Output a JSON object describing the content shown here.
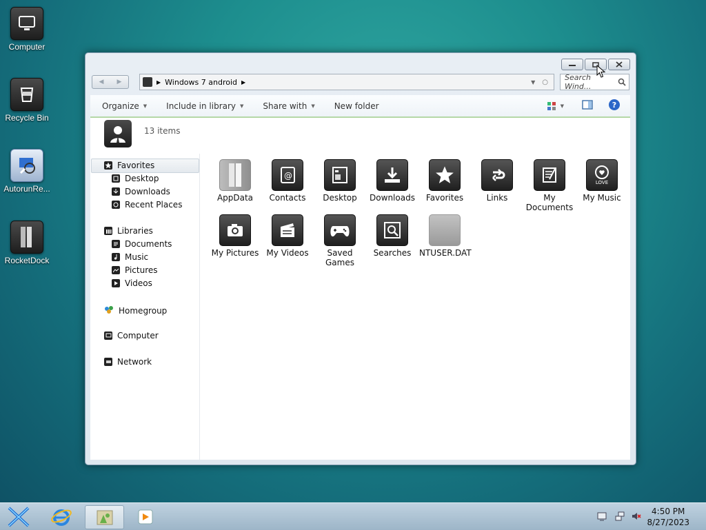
{
  "desktop": {
    "icons": [
      {
        "label": "Computer",
        "icon": "computer-icon"
      },
      {
        "label": "Recycle Bin",
        "icon": "recycle-bin-icon"
      },
      {
        "label": "AutorunRe...",
        "icon": "autorun-icon"
      },
      {
        "label": "RocketDock",
        "icon": "rocketdock-icon"
      }
    ]
  },
  "window": {
    "address": {
      "root_icon": "user-icon",
      "segment": "Windows 7 android"
    },
    "search_placeholder": "Search Wind...",
    "toolbar": {
      "organize": "Organize",
      "include": "Include in library",
      "share": "Share with",
      "new_folder": "New folder"
    },
    "info": {
      "count": "13 items"
    },
    "nav": {
      "favorites": "Favorites",
      "desktop": "Desktop",
      "downloads": "Downloads",
      "recent": "Recent Places",
      "libraries": "Libraries",
      "documents": "Documents",
      "music": "Music",
      "pictures": "Pictures",
      "videos": "Videos",
      "homegroup": "Homegroup",
      "computer": "Computer",
      "network": "Network"
    },
    "files": [
      {
        "label": "AppData",
        "icon": "folder-icon"
      },
      {
        "label": "Contacts",
        "icon": "contacts-icon"
      },
      {
        "label": "Desktop",
        "icon": "desktop-icon"
      },
      {
        "label": "Downloads",
        "icon": "download-icon"
      },
      {
        "label": "Favorites",
        "icon": "star-icon"
      },
      {
        "label": "Links",
        "icon": "links-icon"
      },
      {
        "label": "My Documents",
        "icon": "document-icon"
      },
      {
        "label": "My Music",
        "icon": "music-icon"
      },
      {
        "label": "My Pictures",
        "icon": "camera-icon"
      },
      {
        "label": "My Videos",
        "icon": "video-icon"
      },
      {
        "label": "Saved Games",
        "icon": "gamepad-icon"
      },
      {
        "label": "Searches",
        "icon": "search-icon"
      },
      {
        "label": "NTUSER.DAT",
        "icon": "file-icon"
      }
    ]
  },
  "taskbar": {
    "time": "4:50 PM",
    "date": "8/27/2023"
  }
}
